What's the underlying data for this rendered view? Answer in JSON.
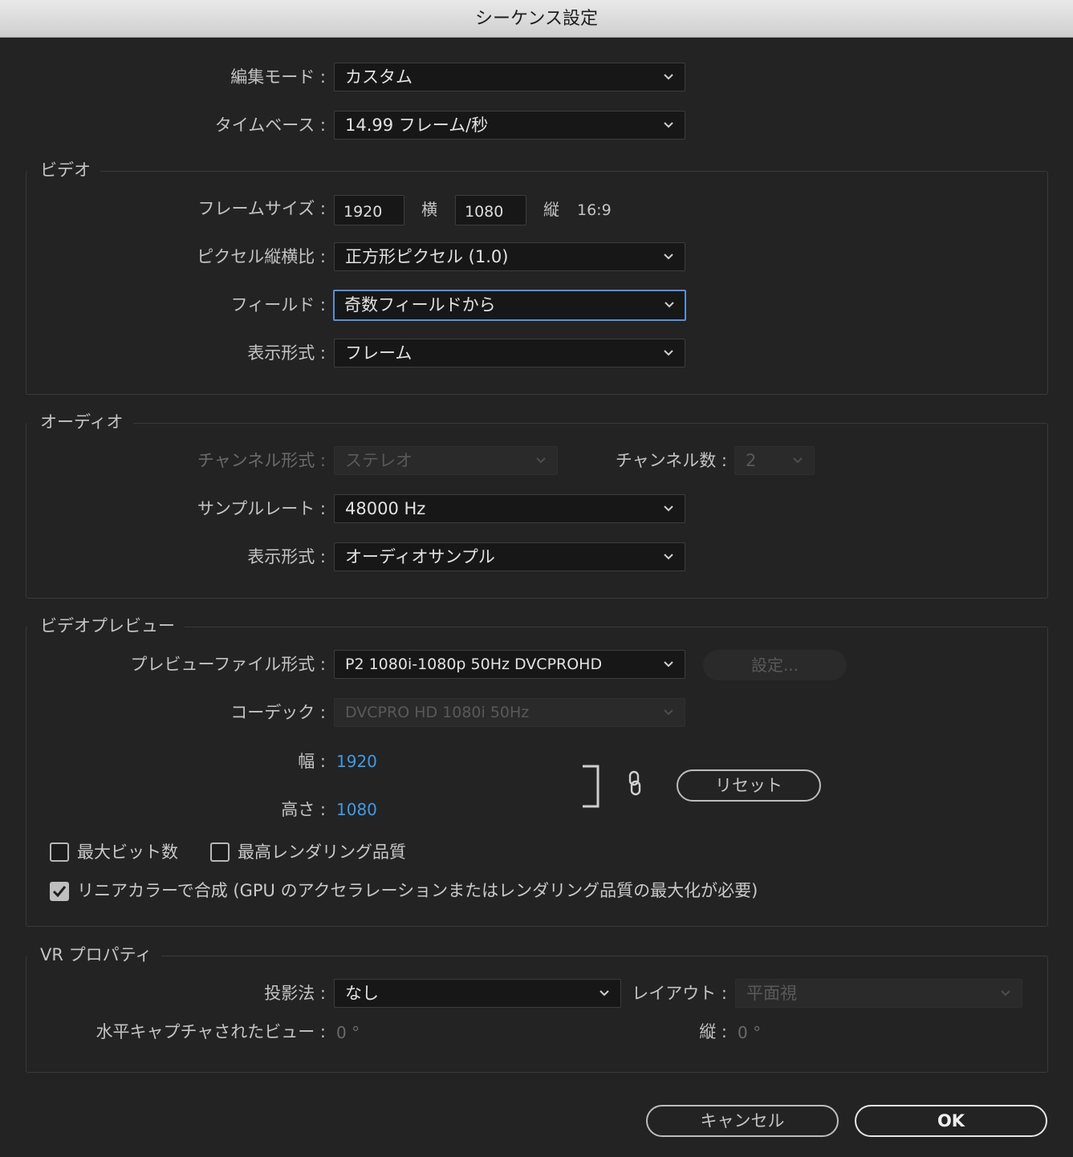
{
  "window": {
    "title": "シーケンス設定"
  },
  "top": {
    "edit_mode": {
      "label": "編集モード :",
      "value": "カスタム"
    },
    "timebase": {
      "label": "タイムベース :",
      "value": "14.99  フレーム/秒"
    }
  },
  "video": {
    "legend": "ビデオ",
    "frame_size": {
      "label": "フレームサイズ :",
      "width": "1920",
      "h_label": "横",
      "height": "1080",
      "v_label": "縦",
      "aspect": "16:9"
    },
    "pixel_aspect": {
      "label": "ピクセル縦横比 :",
      "value": "正方形ピクセル (1.0)"
    },
    "fields": {
      "label": "フィールド :",
      "value": "奇数フィールドから"
    },
    "display_format": {
      "label": "表示形式 :",
      "value": "フレーム"
    }
  },
  "audio": {
    "legend": "オーディオ",
    "channel_format": {
      "label": "チャンネル形式 :",
      "value": "ステレオ"
    },
    "channel_count": {
      "label": "チャンネル数 :",
      "value": "2"
    },
    "sample_rate": {
      "label": "サンプルレート :",
      "value": "48000 Hz"
    },
    "display_format": {
      "label": "表示形式 :",
      "value": "オーディオサンプル"
    }
  },
  "preview": {
    "legend": "ビデオプレビュー",
    "file_format": {
      "label": "プレビューファイル形式 :",
      "value": "P2 1080i-1080p 50Hz DVCPROHD"
    },
    "settings_button": "設定...",
    "codec": {
      "label": "コーデック :",
      "value": "DVCPRO HD 1080i 50Hz"
    },
    "width": {
      "label": "幅 :",
      "value": "1920"
    },
    "height": {
      "label": "高さ :",
      "value": "1080"
    },
    "reset_button": "リセット",
    "max_bit_depth": {
      "label": "最大ビット数",
      "checked": false
    },
    "max_render_quality": {
      "label": "最高レンダリング品質",
      "checked": false
    },
    "linear_color": {
      "label": "リニアカラーで合成 (GPU のアクセラレーションまたはレンダリング品質の最大化が必要)",
      "checked": true
    }
  },
  "vr": {
    "legend": "VR プロパティ",
    "projection": {
      "label": "投影法 :",
      "value": "なし"
    },
    "layout": {
      "label": "レイアウト :",
      "value": "平面視"
    },
    "h_captured_view": {
      "label": "水平キャプチャされたビュー :",
      "value": "0 °"
    },
    "vertical": {
      "label": "縦 :",
      "value": "0 °"
    }
  },
  "buttons": {
    "cancel": "キャンセル",
    "ok": "OK"
  },
  "colors": {
    "background": "#232323",
    "accent_blue": "#3d9be9",
    "focus_border": "#5a8fd6"
  }
}
